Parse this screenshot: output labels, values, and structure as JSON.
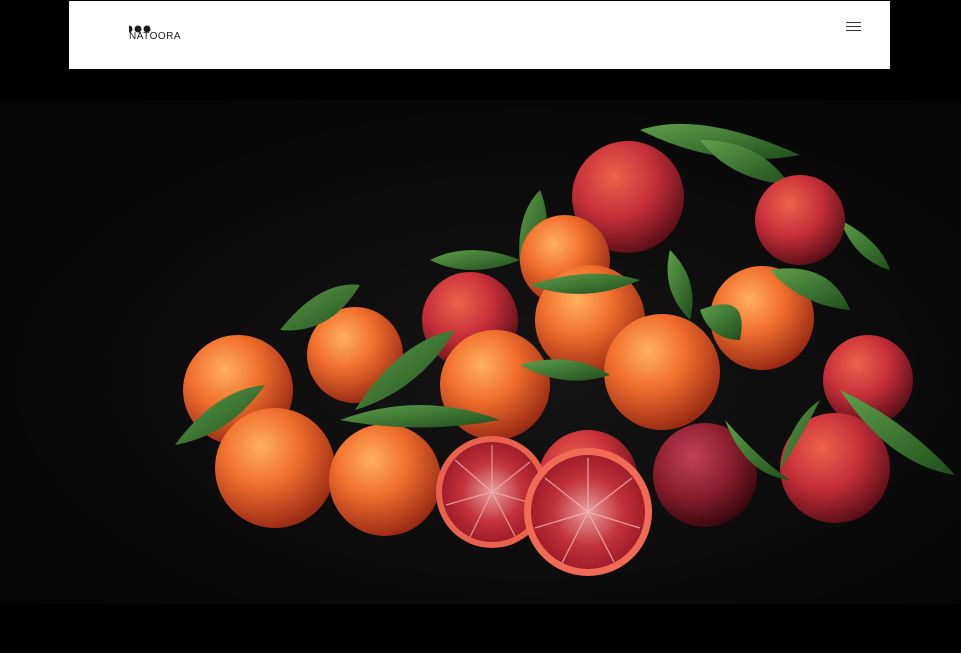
{
  "header": {
    "logo_text": "NATOORA",
    "logo_icon": "three-dots-logo-mark",
    "menu_icon": "hamburger-menu-icon"
  },
  "hero": {
    "image_subject": "blood-oranges-photo"
  },
  "colors": {
    "page_background": "#000000",
    "header_background": "#ffffff",
    "logo": "#1b1b1b",
    "orange": "#ee6b32",
    "blood_orange": "#c8303a",
    "leaf": "#2f6a2a"
  }
}
